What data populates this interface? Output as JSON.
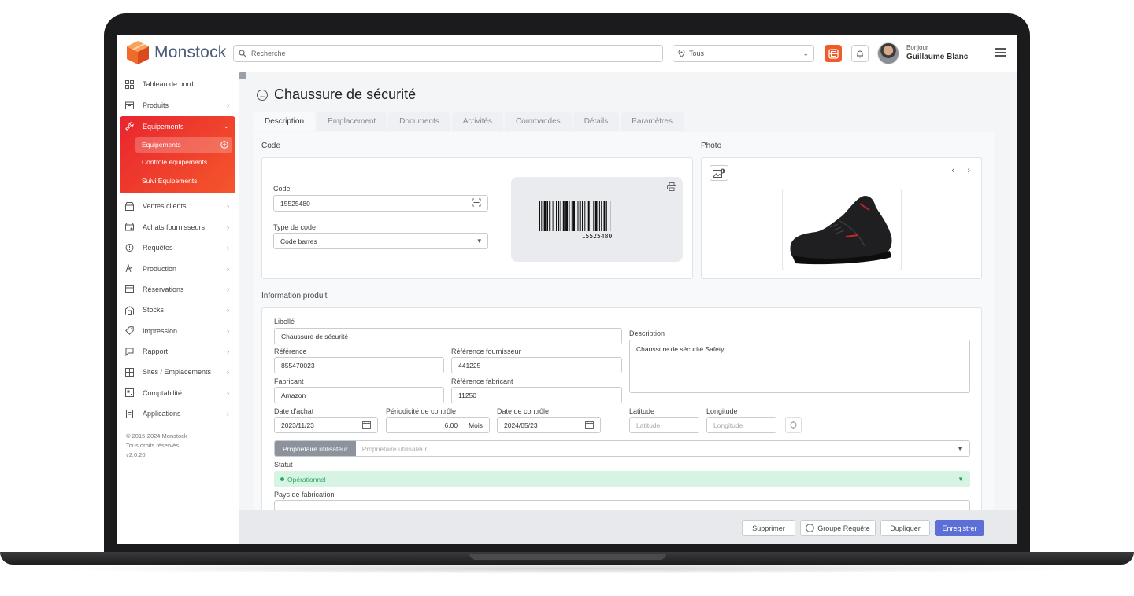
{
  "app": {
    "brand": "Monstock"
  },
  "topbar": {
    "search_placeholder": "Recherche",
    "location_value": "Tous",
    "greeting": "Bonjour",
    "user_name": "Guillaume Blanc"
  },
  "sidebar": {
    "items_top": [
      {
        "label": "Tableau de bord",
        "icon": "dashboard-icon",
        "has_arrow": false
      },
      {
        "label": "Produits",
        "icon": "box-icon",
        "has_arrow": true
      }
    ],
    "active": {
      "label": "Équipements",
      "icon": "wrench-icon",
      "sub": [
        {
          "label": "Equipements"
        },
        {
          "label": "Contrôle équipements"
        },
        {
          "label": "Suivi Equipements"
        }
      ]
    },
    "items_bottom": [
      {
        "label": "Ventes clients",
        "icon": "store-icon"
      },
      {
        "label": "Achats fournisseurs",
        "icon": "supplier-icon"
      },
      {
        "label": "Requêtes",
        "icon": "request-icon"
      },
      {
        "label": "Production",
        "icon": "production-icon"
      },
      {
        "label": "Réservations",
        "icon": "calendar-icon"
      },
      {
        "label": "Stocks",
        "icon": "warehouse-icon"
      },
      {
        "label": "Impression",
        "icon": "tag-icon"
      },
      {
        "label": "Rapport",
        "icon": "report-icon"
      },
      {
        "label": "Sites / Emplacements",
        "icon": "sites-icon"
      },
      {
        "label": "Comptabilité",
        "icon": "accounting-icon"
      },
      {
        "label": "Applications",
        "icon": "apps-icon"
      }
    ],
    "copyright": [
      "© 2015-2024 Monstock",
      "Tous droits réservés.",
      "v2.0.20"
    ]
  },
  "page": {
    "title": "Chaussure de sécurité",
    "tabs": [
      "Description",
      "Emplacement",
      "Documents",
      "Activités",
      "Commandes",
      "Détails",
      "Paramètres"
    ],
    "active_tab": "Description"
  },
  "code_section": {
    "title": "Code",
    "code_label": "Code",
    "code_value": "15525480",
    "type_label": "Type de code",
    "type_value": "Code barres",
    "barcode_text": "15525480"
  },
  "photo_section": {
    "title": "Photo"
  },
  "info_section": {
    "title": "Information produit",
    "libelle_label": "Libellé",
    "libelle_value": "Chaussure de sécurité",
    "description_label": "Description",
    "description_value": "Chaussure de sécurité Safety",
    "reference_label": "Référence",
    "reference_value": "855470023",
    "ref_fournisseur_label": "Référence fournisseur",
    "ref_fournisseur_value": "441225",
    "fabricant_label": "Fabricant",
    "fabricant_value": "Amazon",
    "ref_fabricant_label": "Référence fabricant",
    "ref_fabricant_value": "11250",
    "date_achat_label": "Date d'achat",
    "date_achat_value": "2023/11/23",
    "periodicite_label": "Périodicité de contrôle",
    "periodicite_value": "6.00",
    "periodicite_unit": "Mois",
    "date_controle_label": "Date de contrôle",
    "date_controle_value": "2024/05/23",
    "latitude_label": "Latitude",
    "latitude_placeholder": "Latitude",
    "longitude_label": "Longitude",
    "longitude_placeholder": "Longitude",
    "owner_tag": "Propriétaire utilisateur",
    "owner_placeholder": "Propriétaire utilisateur",
    "statut_label": "Statut",
    "statut_value": "Opérationnel",
    "pays_label": "Pays de fabrication"
  },
  "footer": {
    "delete": "Supprimer",
    "group_request": "Groupe Requête",
    "duplicate": "Dupliquer",
    "save": "Enregistrer"
  },
  "colors": {
    "accent": "#f15a29",
    "active_gradient_start": "#e9252f",
    "primary_button": "#5b6fd6",
    "status_bg": "#d7f3e3",
    "status_text": "#2aa85f"
  }
}
